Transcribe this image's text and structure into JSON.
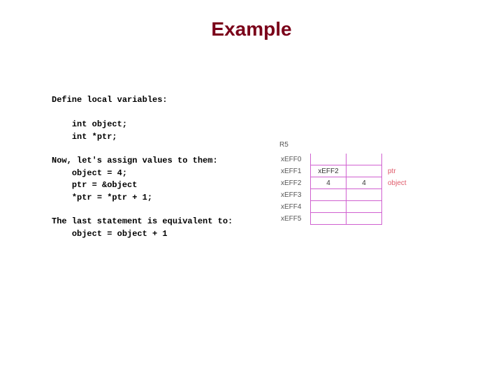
{
  "title": "Example",
  "content": {
    "define": "Define local variables:",
    "decl1": "int object;",
    "decl2": "int *ptr;",
    "assign_hdr": "Now, let's assign values to them:",
    "a1": "object = 4;",
    "a2": "ptr = &object",
    "a3": "*ptr = *ptr + 1;",
    "equiv_hdr": "The last statement is equivalent to:",
    "equiv": "object = object + 1"
  },
  "memory": {
    "heap_label": "R5",
    "rows": [
      {
        "addr": "xEFF0",
        "v1": "",
        "v2": "",
        "note": ""
      },
      {
        "addr": "xEFF1",
        "v1": "xEFF2",
        "v2": "",
        "note": "ptr"
      },
      {
        "addr": "xEFF2",
        "v1": "4",
        "v2": "4",
        "note": "object"
      },
      {
        "addr": "xEFF3",
        "v1": "",
        "v2": "",
        "note": ""
      },
      {
        "addr": "xEFF4",
        "v1": "",
        "v2": "",
        "note": ""
      },
      {
        "addr": "xEFF5",
        "v1": "",
        "v2": "",
        "note": ""
      }
    ]
  }
}
